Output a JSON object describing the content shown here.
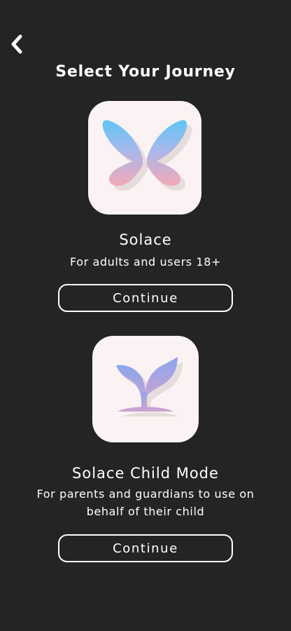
{
  "header": {
    "back_icon": "chevron-left-icon",
    "title": "Select Your Journey"
  },
  "options": [
    {
      "icon": "butterfly-icon",
      "title": "Solace",
      "description": "For adults and users 18+",
      "button_label": "Continue"
    },
    {
      "icon": "sprout-icon",
      "title": "Solace Child Mode",
      "description": "For parents and guardians to use on behalf of their child",
      "button_label": "Continue"
    }
  ],
  "colors": {
    "background": "#242424",
    "icon_tile": "#fbf3f3",
    "gradient_blue": "#5ec6f5",
    "gradient_pink": "#f4a8b8",
    "sprout_top": "#8aa6ee",
    "sprout_bottom": "#c9a3d4"
  }
}
